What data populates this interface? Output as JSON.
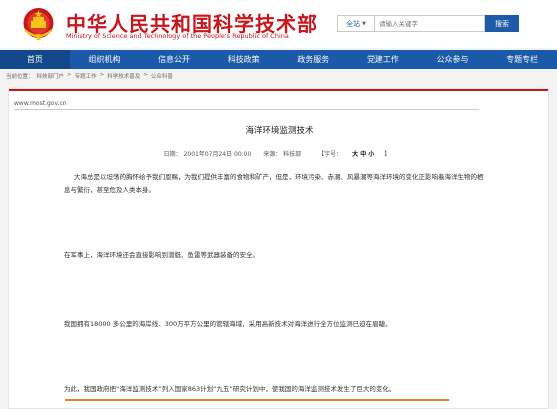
{
  "header": {
    "title": "中华人民共和国科学技术部",
    "subtitle": "Ministry of Science and Technology of the People's Republic of China",
    "emblem_icon": "national-emblem-icon",
    "brand_color": "#c8161d"
  },
  "search": {
    "scope": "全站",
    "placeholder": "请输入关键字",
    "button": "搜索"
  },
  "nav": {
    "color": "#1b5aa9",
    "items": [
      "首页",
      "组织机构",
      "信息公开",
      "科技政策",
      "政务服务",
      "党建工作",
      "公众参与",
      "专题专栏"
    ]
  },
  "breadcrumb": {
    "label": "当前位置：",
    "items": [
      "科技部门户",
      "专题工作",
      "科学技术普及",
      "公众科普"
    ],
    "separator": ">"
  },
  "article": {
    "domain": "www.most.gov.cn",
    "title": "海洋环境监测技术",
    "date": "日期：  2001年07月24日   00:00",
    "source": "来源：  科技部",
    "font_size_label": "【字号：",
    "font_sizes": "大 中 小",
    "font_size_close": "】",
    "paragraphs": [
      "大海总是以坦荡的胸怀给予我们恩赐，为我们提供丰富的食物和矿产，但是，环境污染、赤潮、风暴潮等海洋环境的变化正影响着海洋生物的栖息与繁衍，甚至危及人类本身。",
      "在军事上，海洋环境还会直接影响到潜艇、鱼雷等武器装备的安全。",
      "我国拥有18000 多公里的海岸线、300万平方公里的管辖海域，采用高新技术对海洋进行全方位监测已迫在眉睫。",
      "为此，我国政府把“海洋监测技术”列入国家863计划“九五”研究计划中，使我国的海洋监测技术发生了巨大的变化。"
    ],
    "highlight_color": "#f07f1b"
  }
}
